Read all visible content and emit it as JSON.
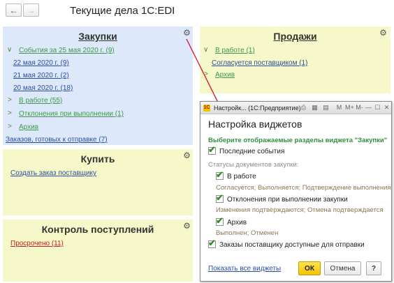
{
  "header": {
    "back_glyph": "←",
    "forward_glyph": "→",
    "title": "Текущие дела 1С:EDI"
  },
  "purchases": {
    "title": "Закупки",
    "gear_glyph": "⚙",
    "events": "События за 25 мая 2020 г. (9)",
    "dates": [
      "22 мая 2020 г. (9)",
      "21 мая 2020 г. (2)",
      "20 мая 2020 г. (18)"
    ],
    "in_work": "В работе (55)",
    "deviations": "Отклонения при выполнении (1)",
    "archive": "Архив",
    "ready_orders": "Заказов, готовых к отправке (7)"
  },
  "sales": {
    "title": "Продажи",
    "gear_glyph": "⚙",
    "in_work": "В работе (1)",
    "agreeing": "Согласуется поставщиком (1)",
    "archive": "Архив"
  },
  "buy": {
    "title": "Купить",
    "gear_glyph": "⚙",
    "create_order": "Создать заказ поставщику"
  },
  "control": {
    "title": "Контроль поступлений",
    "gear_glyph": "⚙",
    "overdue": "Просрочено (11)"
  },
  "dialog": {
    "window_title": "Настройк... (1С:Предприятие)",
    "logo": "1С",
    "heading": "Настройка виджетов",
    "hint": "Выберите отображаемые разделы виджета \"Закупки\"",
    "last_events": "Последние события",
    "statuses_label": "Статусы документов закупки:",
    "in_work": "В работе",
    "in_work_desc": "Согласуется; Выполняется; Подтверждение выполнения",
    "deviations": "Отклонения при выполнении закупки",
    "deviations_desc": "Изменения подтверждаются; Отмена подтверждается",
    "archive": "Архив",
    "archive_desc": "Выполнен; Отменен",
    "orders_available": "Заказы поставщику доступные для отправки",
    "show_all": "Показать все виджеты",
    "ok": "ОК",
    "cancel": "Отмена",
    "help": "?",
    "check_glyph": "✔",
    "toolbar_glyphs": [
      "⎙",
      "▦",
      "▤",
      "M",
      "M+",
      "M-",
      "—",
      "☐",
      "✕"
    ]
  },
  "colors": {
    "purchases_bg": "#dde8fa",
    "yellow_bg": "#f6f8c9",
    "ok_yellow": "#f2c200",
    "green_link": "#3c9a4a",
    "red_link": "#cc1b1b",
    "arrow_red": "#d4141e"
  }
}
